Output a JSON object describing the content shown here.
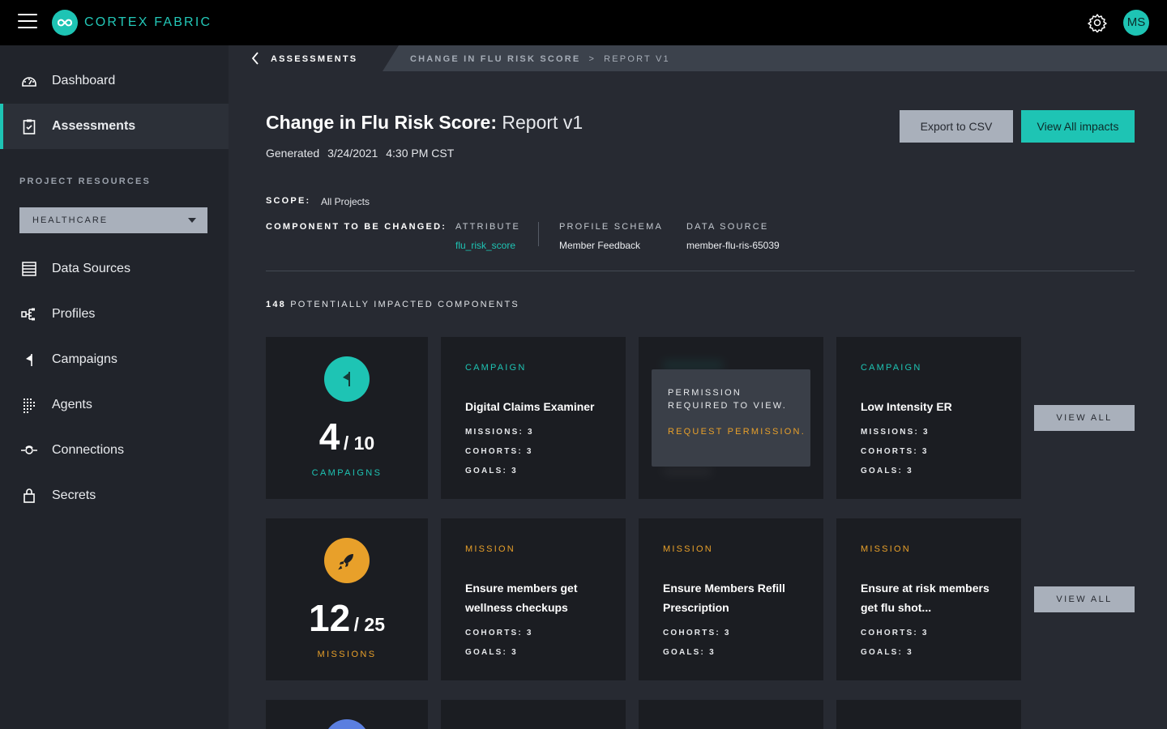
{
  "app": {
    "brand": "CORTEX FABRIC",
    "user_initials": "MS",
    "accent": "#1ec4b4",
    "warn": "#e8a02a"
  },
  "sidebar": {
    "top_items": [
      {
        "label": "Dashboard",
        "icon": "dashboard-icon"
      },
      {
        "label": "Assessments",
        "icon": "clipboard-icon",
        "active": true
      }
    ],
    "resources_heading": "PROJECT RESOURCES",
    "project_select": "HEALTHCARE",
    "items": [
      {
        "label": "Data Sources",
        "icon": "data-sources-icon"
      },
      {
        "label": "Profiles",
        "icon": "profiles-icon"
      },
      {
        "label": "Campaigns",
        "icon": "flag-icon"
      },
      {
        "label": "Agents",
        "icon": "agents-icon"
      },
      {
        "label": "Connections",
        "icon": "connections-icon"
      },
      {
        "label": "Secrets",
        "icon": "lock-icon"
      }
    ]
  },
  "breadcrumb": {
    "back": "ASSESSMENTS",
    "parent": "CHANGE IN FLU RISK SCORE",
    "separator": ">",
    "current": "REPORT V1"
  },
  "report": {
    "title_bold": "Change in Flu Risk Score:",
    "title_normal": "Report v1",
    "generated_label": "Generated",
    "generated_date": "3/24/2021",
    "generated_time": "4:30 PM CST",
    "export_label": "Export to CSV",
    "view_all_label": "View All impacts",
    "scope_label": "SCOPE:",
    "scope_value": "All Projects",
    "component_label": "COMPONENT TO BE CHANGED:",
    "attribute_label": "ATTRIBUTE",
    "attribute_value": "flu_risk_score",
    "schema_label": "PROFILE SCHEMA",
    "schema_value": "Member Feedback",
    "source_label": "DATA SOURCE",
    "source_value": "member-flu-ris-65039",
    "impacted_count": "148",
    "impacted_label": "POTENTIALLY IMPACTED COMPONENTS"
  },
  "rows": [
    {
      "summary": {
        "count": "4",
        "total": "/ 10",
        "label": "CAMPAIGNS",
        "icon": "flag-icon",
        "color": "#1ec4b4"
      },
      "cards": [
        {
          "type": "CAMPAIGN",
          "name": "Digital Claims Examiner",
          "stats": [
            "MISSIONS: 3",
            "COHORTS: 3",
            "GOALS: 3"
          ]
        },
        {
          "permission_text": "PERMISSION REQUIRED TO VIEW.",
          "request_text": "REQUEST PERMISSION."
        },
        {
          "type": "CAMPAIGN",
          "name": "Low Intensity ER",
          "stats": [
            "MISSIONS: 3",
            "COHORTS: 3",
            "GOALS: 3"
          ]
        }
      ],
      "view_all": "VIEW ALL"
    },
    {
      "summary": {
        "count": "12",
        "total": "/ 25",
        "label": "MISSIONS",
        "icon": "rocket-icon",
        "color": "#e8a02a"
      },
      "cards": [
        {
          "type": "MISSION",
          "name": "Ensure members get wellness checkups",
          "stats": [
            "COHORTS: 3",
            "GOALS: 3"
          ]
        },
        {
          "type": "MISSION",
          "name": "Ensure Members Refill Prescription",
          "stats": [
            "COHORTS: 3",
            "GOALS: 3"
          ]
        },
        {
          "type": "MISSION",
          "name": "Ensure at risk members get flu shot...",
          "stats": [
            "COHORTS: 3",
            "GOALS: 3"
          ]
        }
      ],
      "view_all": "VIEW ALL"
    }
  ]
}
